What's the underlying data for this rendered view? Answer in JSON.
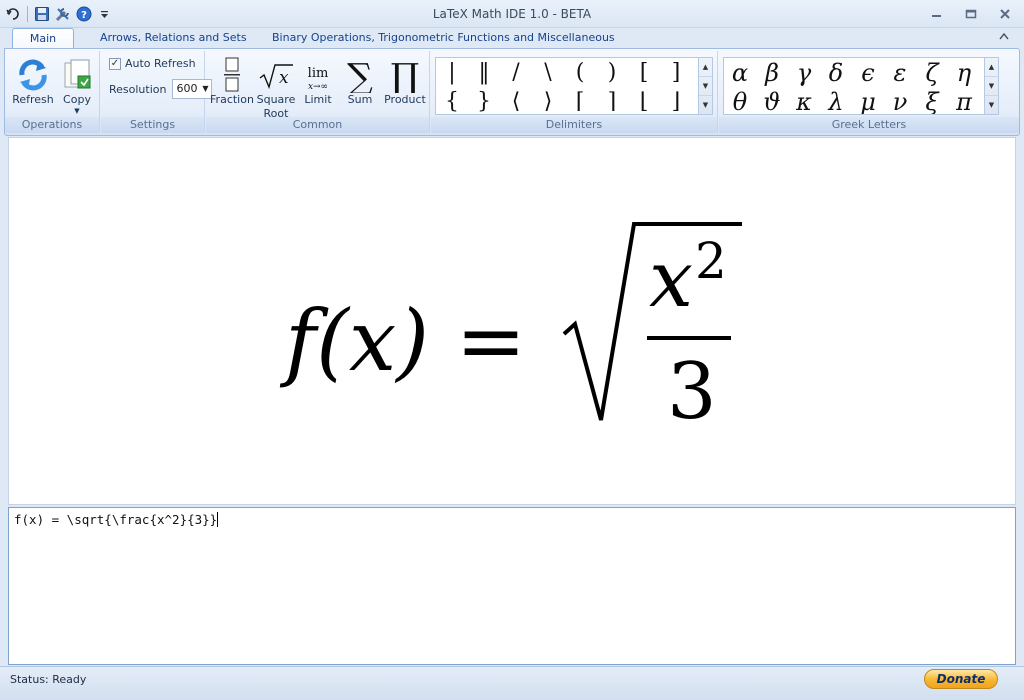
{
  "window": {
    "title": "LaTeX Math IDE 1.0 - BETA"
  },
  "tabs": [
    {
      "label": "Main"
    },
    {
      "label": "Arrows, Relations and Sets"
    },
    {
      "label": "Binary Operations, Trigonometric Functions and Miscellaneous"
    }
  ],
  "ribbon": {
    "operations": {
      "label": "Operations",
      "refresh": "Refresh",
      "copy": "Copy"
    },
    "settings": {
      "label": "Settings",
      "auto_refresh": "Auto Refresh",
      "auto_refresh_checked": true,
      "resolution_label": "Resolution",
      "resolution_value": "600"
    },
    "common": {
      "label": "Common",
      "fraction": "Fraction",
      "square_root_1": "Square",
      "square_root_2": "Root",
      "limit": "Limit",
      "sum": "Sum",
      "product": "Product"
    },
    "delimiters": {
      "label": "Delimiters",
      "row1": [
        "|",
        "‖",
        "/",
        "\\",
        "(",
        ")",
        "[",
        "]"
      ],
      "row2": [
        "{",
        "}",
        "⟨",
        "⟩",
        "⌈",
        "⌉",
        "⌊",
        "⌋"
      ]
    },
    "greek": {
      "label": "Greek Letters",
      "row1": [
        "α",
        "β",
        "γ",
        "δ",
        "ϵ",
        "ε",
        "ζ",
        "η"
      ],
      "row2": [
        "θ",
        "ϑ",
        "κ",
        "λ",
        "μ",
        "ν",
        "ξ",
        "π"
      ]
    }
  },
  "preview": {
    "lhs": "f(x) =",
    "numerator": "x",
    "exponent": "2",
    "denominator": "3"
  },
  "editor": {
    "text": "f(x) = \\sqrt{\\frac{x^2}{3}}"
  },
  "status": {
    "text": "Status: Ready",
    "donate": "Donate"
  },
  "colors": {
    "accent": "#15428b",
    "ribbon_border": "#9fbbe3",
    "donate": "#f7b731"
  }
}
